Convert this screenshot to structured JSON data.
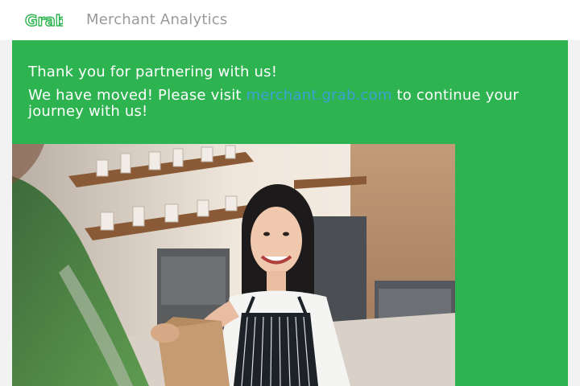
{
  "header": {
    "logo_text": "Grab",
    "app_title": "Merchant Analytics"
  },
  "banner": {
    "greeting": "Thank you for partnering with us!",
    "message_before": "We have moved! Please visit ",
    "link_text": "merchant.grab.com",
    "message_after": " to continue your journey with us!"
  },
  "colors": {
    "brand_green": "#2db34f",
    "link_blue": "#3ea0d6",
    "header_bg": "#ffffff",
    "title_gray": "#9a9a9a"
  },
  "photo": {
    "subject": "merchant-handing-order-photo"
  }
}
